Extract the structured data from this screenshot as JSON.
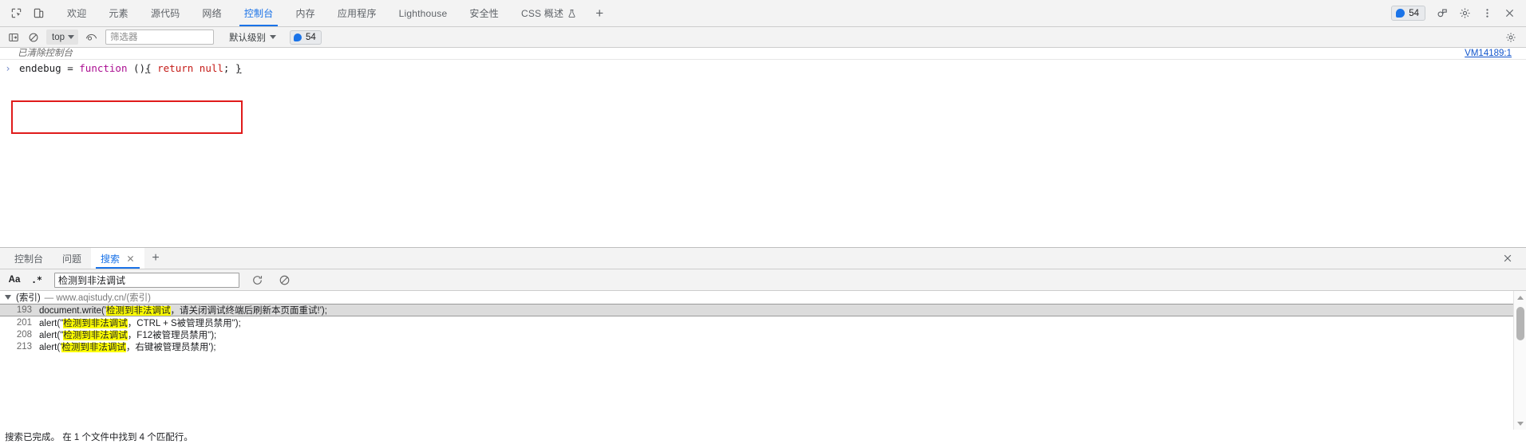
{
  "topbar": {
    "icons": [
      {
        "name": "inspect-element-icon",
        "glyph": "inspect"
      },
      {
        "name": "device-toolbar-icon",
        "glyph": "device"
      }
    ],
    "tabs": [
      {
        "label": "欢迎",
        "active": false,
        "flask": false
      },
      {
        "label": "元素",
        "active": false,
        "flask": false
      },
      {
        "label": "源代码",
        "active": false,
        "flask": false
      },
      {
        "label": "网络",
        "active": false,
        "flask": false
      },
      {
        "label": "控制台",
        "active": true,
        "flask": false
      },
      {
        "label": "内存",
        "active": false,
        "flask": false
      },
      {
        "label": "应用程序",
        "active": false,
        "flask": false
      },
      {
        "label": "Lighthouse",
        "active": false,
        "flask": false
      },
      {
        "label": "安全性",
        "active": false,
        "flask": false
      },
      {
        "label": "CSS 概述",
        "active": false,
        "flask": true
      }
    ],
    "add_tab_label": "+",
    "message_badge": {
      "count": "54",
      "name": "issues-count-badge"
    },
    "right_icons": [
      {
        "name": "devtools-feedback-icon"
      },
      {
        "name": "settings-gear-icon"
      },
      {
        "name": "more-options-kebab-icon"
      },
      {
        "name": "close-devtools-icon"
      }
    ],
    "accent_color": "#1a73e8"
  },
  "console_toolbar": {
    "sidebar_toggle_name": "console-sidebar-toggle-icon",
    "clear_console_name": "clear-console-icon",
    "context_selector": {
      "value": "top",
      "name": "javascript-context-selector"
    },
    "eye_icon_name": "live-expression-eye-icon",
    "filter": {
      "placeholder": "筛选器",
      "value": "",
      "name": "console-filter-input"
    },
    "level_selector": {
      "value": "默认级别",
      "name": "log-level-selector"
    },
    "count_badge": {
      "count": "54",
      "name": "console-issues-badge"
    },
    "settings_gear_name": "console-settings-gear-icon"
  },
  "console_body": {
    "cleared_message": "已清除控制台",
    "vm_link": "VM14189:1",
    "prompt_caret": "›",
    "code": {
      "part1": "endebug = ",
      "kw_function": "function",
      "part2": " ()",
      "brace_open": "{",
      "kw_return": " return null",
      "semi": "; ",
      "brace_close": "}"
    },
    "annotation_name": "red-highlight-rectangle",
    "annotation_color": "#e01b1b"
  },
  "drawer": {
    "tabs": [
      {
        "label": "控制台",
        "active": false,
        "closable": false
      },
      {
        "label": "问题",
        "active": false,
        "closable": false
      },
      {
        "label": "搜索",
        "active": true,
        "closable": true
      }
    ],
    "add_tab_label": "+",
    "close_drawer_name": "close-drawer-icon",
    "search_toolbar": {
      "match_case_label": "Aa",
      "regex_label": ".*",
      "input_value": "检测到非法调试",
      "input_placeholder": "",
      "refresh_name": "refresh-search-icon",
      "clear_name": "clear-search-icon"
    },
    "results": {
      "file_header": {
        "name": "(索引)",
        "url": "— www.aqistudy.cn/(索引)"
      },
      "match_term": "检测到非法调试",
      "rows": [
        {
          "line": "193",
          "pre": "document.write('",
          "match": "检测到非法调试",
          "post": "，请关闭调试终端后刷新本页面重试!');",
          "selected": true
        },
        {
          "line": "201",
          "pre": "alert(\"",
          "match": "检测到非法调试",
          "post": "，CTRL + S被管理员禁用\");",
          "selected": false
        },
        {
          "line": "208",
          "pre": "alert(\"",
          "match": "检测到非法调试",
          "post": "，F12被管理员禁用\");",
          "selected": false
        },
        {
          "line": "213",
          "pre": "alert('",
          "match": "检测到非法调试",
          "post": "，右键被管理员禁用');",
          "selected": false
        }
      ],
      "highlight_color": "#ffff00"
    },
    "status": "搜索已完成。 在 1 个文件中找到 4 个匹配行。"
  }
}
